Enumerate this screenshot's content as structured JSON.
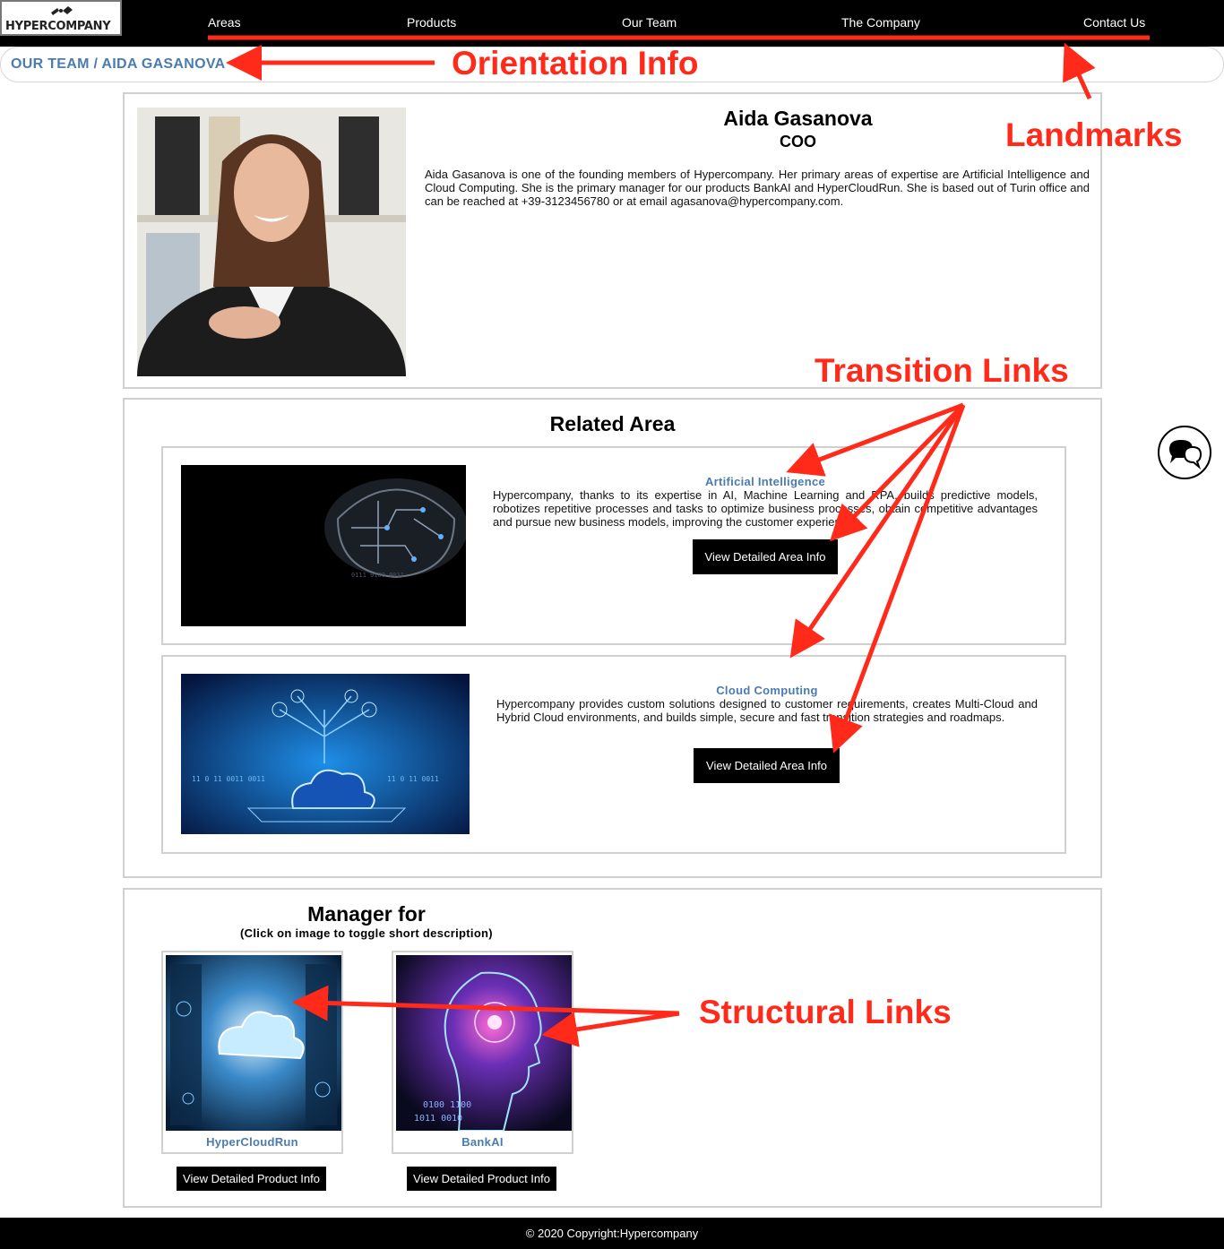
{
  "brand": {
    "logo_text": "HYPERCOMPANY"
  },
  "nav": {
    "items": [
      {
        "label": "Areas"
      },
      {
        "label": "Products"
      },
      {
        "label": "Our Team"
      },
      {
        "label": "The Company"
      },
      {
        "label": "Contact Us"
      }
    ]
  },
  "breadcrumb": {
    "text": "OUR TEAM / AIDA GASANOVA"
  },
  "profile": {
    "name": "Aida Gasanova",
    "role": "COO",
    "bio": "Aida Gasanova is one of the founding members of Hypercompany. Her primary areas of expertise are Artificial Intelligence and Cloud Computing. She is the primary manager for our products BankAI and HyperCloudRun. She is based out of Turin office and can be reached at +39-3123456780 or at email agasanova@hypercompany.com."
  },
  "related": {
    "title": "Related Area",
    "areas": [
      {
        "title": "Artificial Intelligence",
        "description": "Hypercompany, thanks to its expertise in AI, Machine Learning and RPA, builds predictive models, robotizes repetitive processes and tasks to optimize business processes, obtain competitive advantages and pursue new business models, improving the customer experience.",
        "button": "View Detailed Area Info"
      },
      {
        "title": "Cloud Computing",
        "description": "Hypercompany provides custom solutions designed to customer requirements, creates Multi-Cloud and Hybrid Cloud environments, and builds simple, secure and fast transition strategies and roadmaps.",
        "button": "View Detailed Area Info"
      }
    ]
  },
  "manager": {
    "title": "Manager for",
    "subtitle": "(Click on image to toggle short description)",
    "products": [
      {
        "name": "HyperCloudRun",
        "button": "View Detailed Product Info"
      },
      {
        "name": "BankAI",
        "button": "View Detailed Product Info"
      }
    ]
  },
  "footer": {
    "text": "© 2020  Copyright:Hypercompany"
  },
  "annotations": {
    "orientation": "Orientation Info",
    "landmarks": "Landmarks",
    "transition": "Transition Links",
    "structural": "Structural Links"
  },
  "colors": {
    "accent_blue": "#4a7cb0",
    "annotation_red": "#ff2a1a",
    "bar_black": "#000000"
  },
  "icons": [
    "logo-icon",
    "chat-icon"
  ]
}
